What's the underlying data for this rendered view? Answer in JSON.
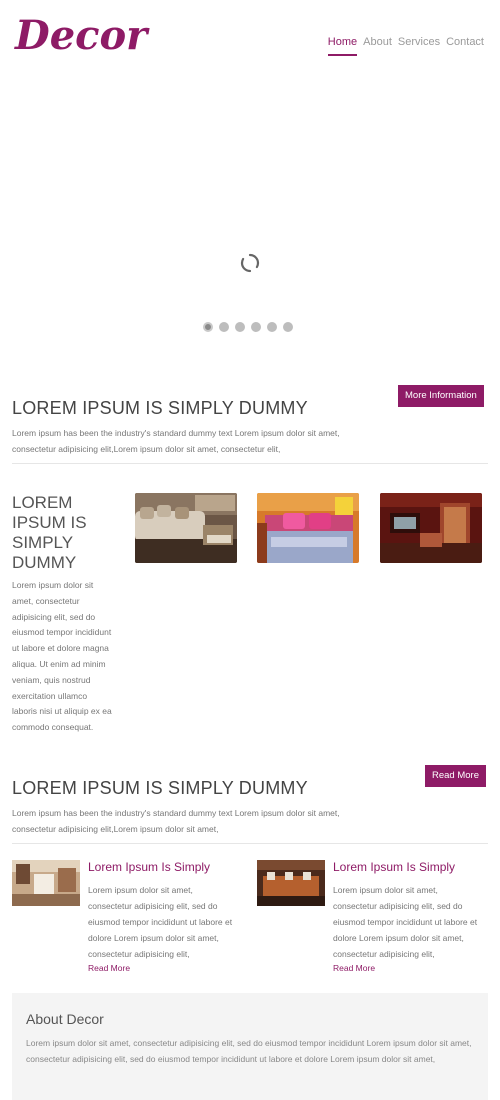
{
  "header": {
    "logo": "Decor",
    "nav": [
      "Home",
      "About",
      "Services",
      "Contact"
    ]
  },
  "slider": {
    "slide_count": 6,
    "active_index": 0
  },
  "intro": {
    "title": "LOREM IPSUM IS SIMPLY DUMMY",
    "text": "Lorem ipsum has been the industry's standard dummy text Lorem ipsum dolor sit amet, consectetur adipisicing elit,Lorem ipsum dolor sit amet, consectetur elit,",
    "button": "More Information"
  },
  "gallery": {
    "title": "LOREM IPSUM IS SIMPLY DUMMY",
    "text": "Lorem ipsum dolor sit amet, consectetur adipisicing elit, sed do eiusmod tempor incididunt ut labore et dolore magna aliqua. Ut enim ad minim veniam, quis nostrud exercitation ullamco laboris nisi ut aliquip ex ea commodo consequat."
  },
  "section2": {
    "title": "LOREM IPSUM IS SIMPLY DUMMY",
    "text": "Lorem ipsum has been the industry's standard dummy text Lorem ipsum dolor sit amet, consectetur adipisicing elit,Lorem ipsum dolor sit amet,",
    "button": "Read More"
  },
  "features": [
    {
      "title": "Lorem Ipsum Is Simply",
      "text": "Lorem ipsum dolor sit amet, consectetur adipisicing elit, sed do eiusmod tempor incididunt ut labore et dolore Lorem ipsum dolor sit amet, consectetur adipisicing elit,",
      "link": "Read More"
    },
    {
      "title": "Lorem Ipsum Is Simply",
      "text": "Lorem ipsum dolor sit amet, consectetur adipisicing elit, sed do eiusmod tempor incididunt ut labore et dolore Lorem ipsum dolor sit amet, consectetur adipisicing elit,",
      "link": "Read More"
    }
  ],
  "about": {
    "title": "About Decor",
    "text": "Lorem ipsum dolor sit amet, consectetur adipisicing elit, sed do eiusmod tempor incididunt Lorem ipsum dolor sit amet, consectetur adipisicing elit, sed do eiusmod tempor incididunt ut labore et dolore Lorem ipsum dolor sit amet,"
  },
  "colors": {
    "brand": "#8e1b66"
  }
}
